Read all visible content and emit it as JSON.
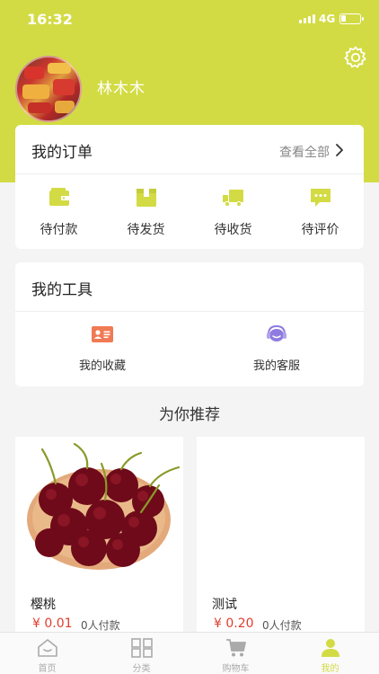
{
  "status_bar": {
    "time": "16:32",
    "network": "4G"
  },
  "profile": {
    "username": "林木木"
  },
  "orders": {
    "title": "我的订单",
    "view_all": "查看全部",
    "items": [
      {
        "label": "待付款",
        "icon": "wallet-icon"
      },
      {
        "label": "待发货",
        "icon": "box-icon"
      },
      {
        "label": "待收货",
        "icon": "truck-icon"
      },
      {
        "label": "待评价",
        "icon": "chat-bubble-icon"
      }
    ]
  },
  "tools": {
    "title": "我的工具",
    "items": [
      {
        "label": "我的收藏",
        "icon": "id-card-icon"
      },
      {
        "label": "我的客服",
        "icon": "customer-service-icon"
      }
    ]
  },
  "recommend": {
    "title": "为你推荐",
    "products": [
      {
        "name": "樱桃",
        "price": "¥ 0.01",
        "sold": "0人付款",
        "image": "cherries"
      },
      {
        "name": "测试",
        "price": "¥ 0.20",
        "sold": "0人付款",
        "image": ""
      }
    ]
  },
  "tabbar": {
    "items": [
      {
        "label": "首页",
        "icon": "home-icon",
        "active": false
      },
      {
        "label": "分类",
        "icon": "grid-icon",
        "active": false
      },
      {
        "label": "购物车",
        "icon": "cart-icon",
        "active": false
      },
      {
        "label": "我的",
        "icon": "user-icon",
        "active": true
      }
    ]
  },
  "colors": {
    "accent": "#d3db44",
    "price": "#e03c2e",
    "icon_orange": "#f07a54",
    "icon_purple": "#8f7be0"
  }
}
